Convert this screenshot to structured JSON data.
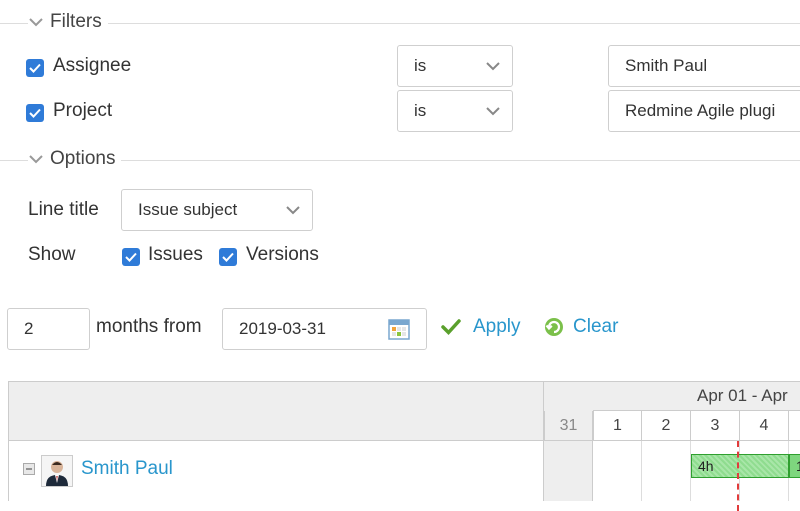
{
  "filters": {
    "legend": "Filters",
    "rows": [
      {
        "label": "Assignee",
        "operator": "is",
        "value": "Smith Paul"
      },
      {
        "label": "Project",
        "operator": "is",
        "value": "Redmine Agile plugi"
      }
    ]
  },
  "options": {
    "legend": "Options",
    "line_title_label": "Line title",
    "line_title_value": "Issue subject",
    "show_label": "Show",
    "show_issues": "Issues",
    "show_versions": "Versions"
  },
  "range": {
    "months": "2",
    "months_from_label": "months from",
    "date": "2019-03-31",
    "apply": "Apply",
    "clear": "Clear"
  },
  "gantt": {
    "week_label": "Apr 01 - Apr",
    "days": [
      "31",
      "1",
      "2",
      "3",
      "4"
    ],
    "user": "Smith Paul",
    "bar_label": "4h",
    "bar_label_2": "1"
  },
  "colors": {
    "link": "#2996cc",
    "checkbox": "#2f7bd8",
    "bar": "#8fdc8f",
    "today_line": "#e23b3b"
  }
}
